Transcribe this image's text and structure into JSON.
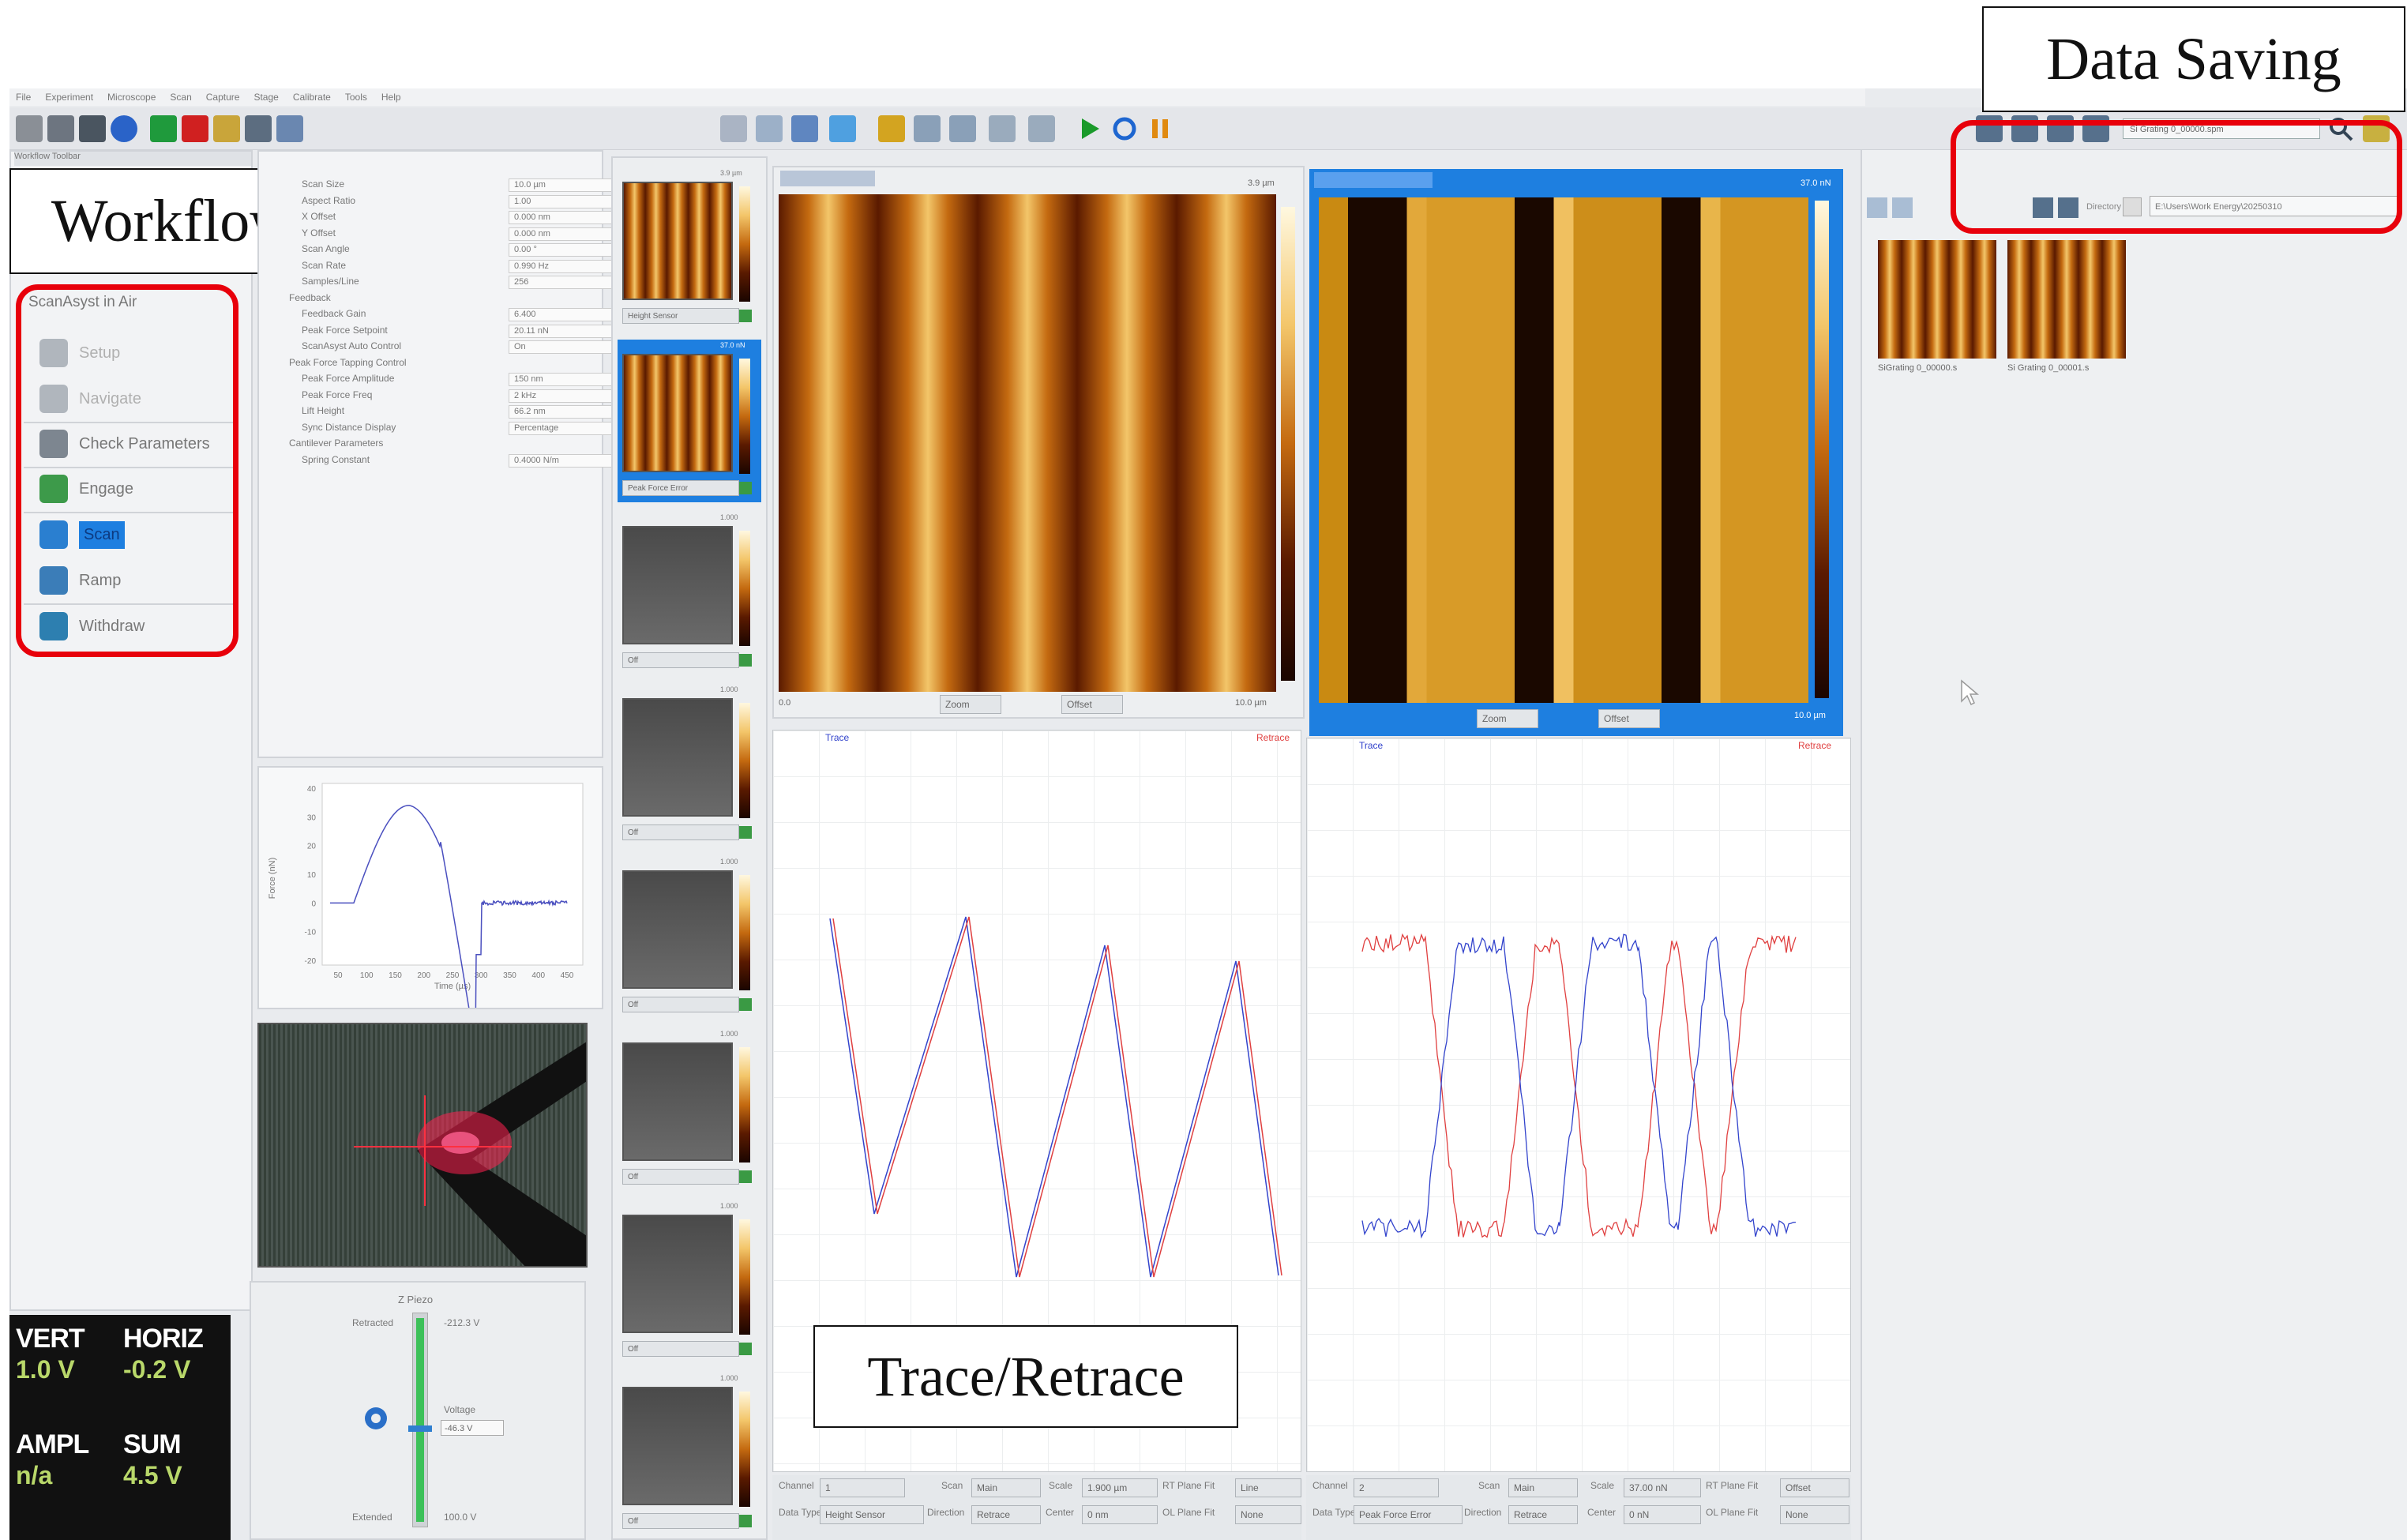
{
  "menu": [
    "File",
    "Experiment",
    "Microscope",
    "Scan",
    "Capture",
    "Stage",
    "Calibrate",
    "Tools",
    "Help"
  ],
  "callouts": {
    "workflow": "Workflow",
    "data_saving": "Data Saving",
    "trace_retrace": "Trace/Retrace"
  },
  "workflow": {
    "toolbar_label": "Workflow Toolbar",
    "experiment": "ScanAsyst in Air",
    "items": [
      "Setup",
      "Navigate",
      "Check Parameters",
      "Engage",
      "Scan",
      "Ramp",
      "Withdraw"
    ]
  },
  "params": [
    {
      "label": "Scan Size",
      "value": "10.0 µm"
    },
    {
      "label": "Aspect Ratio",
      "value": "1.00"
    },
    {
      "label": "X Offset",
      "value": "0.000 nm"
    },
    {
      "label": "Y Offset",
      "value": "0.000 nm"
    },
    {
      "label": "Scan Angle",
      "value": "0.00 °"
    },
    {
      "label": "Scan Rate",
      "value": "0.990 Hz"
    },
    {
      "label": "Samples/Line",
      "value": "256"
    },
    {
      "label": "Feedback",
      "value": ""
    },
    {
      "label": "Feedback Gain",
      "value": "6.400"
    },
    {
      "label": "Peak Force Setpoint",
      "value": "20.11 nN"
    },
    {
      "label": "ScanAsyst Auto Control",
      "value": "On"
    },
    {
      "label": "Peak Force Tapping Control",
      "value": ""
    },
    {
      "label": "Peak Force Amplitude",
      "value": "150 nm"
    },
    {
      "label": "Peak Force Freq",
      "value": "2 kHz"
    },
    {
      "label": "Lift Height",
      "value": "66.2 nm"
    },
    {
      "label": "Sync Distance Display",
      "value": "Percentage"
    },
    {
      "label": "Cantilever Parameters",
      "value": ""
    },
    {
      "label": "Spring Constant",
      "value": "0.4000 N/m"
    }
  ],
  "force_plot": {
    "ylabel": "Force (nN)",
    "xlabel": "Time (µs)",
    "yticks": [
      "40",
      "30",
      "20",
      "10",
      "0",
      "-10",
      "-20"
    ],
    "xticks": [
      "50",
      "100",
      "150",
      "200",
      "250",
      "300",
      "350",
      "400",
      "450"
    ]
  },
  "channel_thumbs": [
    {
      "label": "Height Sensor",
      "range": "3.9 µm"
    },
    {
      "label": "Peak Force Error",
      "range": "37.0 nN"
    },
    {
      "label": "Off",
      "range": "1.000"
    },
    {
      "label": "Off",
      "range": "1.000"
    },
    {
      "label": "Off",
      "range": "1.000"
    },
    {
      "label": "Off",
      "range": "1.000"
    },
    {
      "label": "Off",
      "range": "1.000"
    },
    {
      "label": "Off",
      "range": "1.000"
    }
  ],
  "image1": {
    "range": "3.9 µm",
    "x0": "0.0",
    "x1": "10.0 µm",
    "btn1": "Zoom",
    "btn2": "Offset"
  },
  "image2": {
    "range": "37.0 nN",
    "x1": "10.0 µm",
    "btn1": "Zoom",
    "btn2": "Offset"
  },
  "trace_labels": {
    "trace": "Trace",
    "retrace": "Retrace"
  },
  "bottom1": {
    "channel_label": "Channel",
    "channel": "1",
    "scan_label": "Scan",
    "scan": "Main",
    "scale_label": "Scale",
    "scale": "1.900 µm",
    "rt_label": "RT Plane Fit",
    "rt": "Line",
    "datatype_label": "Data Type",
    "datatype": "Height Sensor",
    "direction_label": "Direction",
    "direction": "Retrace",
    "center_label": "Center",
    "center": "0 nm",
    "ol_label": "OL Plane Fit",
    "ol": "None"
  },
  "bottom2": {
    "channel_label": "Channel",
    "channel": "2",
    "scan_label": "Scan",
    "scan": "Main",
    "scale_label": "Scale",
    "scale": "37.00 nN",
    "rt_label": "RT Plane Fit",
    "rt": "Offset",
    "datatype_label": "Data Type",
    "datatype": "Peak Force Error",
    "direction_label": "Direction",
    "direction": "Retrace",
    "center_label": "Center",
    "center": "0 nN",
    "ol_label": "OL Plane Fit",
    "ol": "None"
  },
  "zpiezo": {
    "title": "Z Piezo",
    "retracted_label": "Retracted",
    "retracted": "-212.3 V",
    "extended_label": "Extended",
    "extended": "100.0 V",
    "voltage_label": "Voltage",
    "voltage": "-46.3 V"
  },
  "status": [
    {
      "title": "VERT",
      "value": "1.0 V"
    },
    {
      "title": "HORIZ",
      "value": "-0.2 V"
    },
    {
      "title": "AMPL",
      "value": "n/a"
    },
    {
      "title": "SUM",
      "value": "4.5 V"
    }
  ],
  "saving": {
    "filename": "Si Grating 0_00000.spm",
    "dir_label": "Directory",
    "dir": "E:\\Users\\Work Energy\\20250310",
    "files": [
      "SiGrating 0_00000.s",
      "Si Grating 0_00001.s"
    ]
  },
  "colors": {
    "red": "#e8000b",
    "accent_blue": "#1e7fe0",
    "trace": "#3344cc",
    "retrace": "#e04040"
  }
}
